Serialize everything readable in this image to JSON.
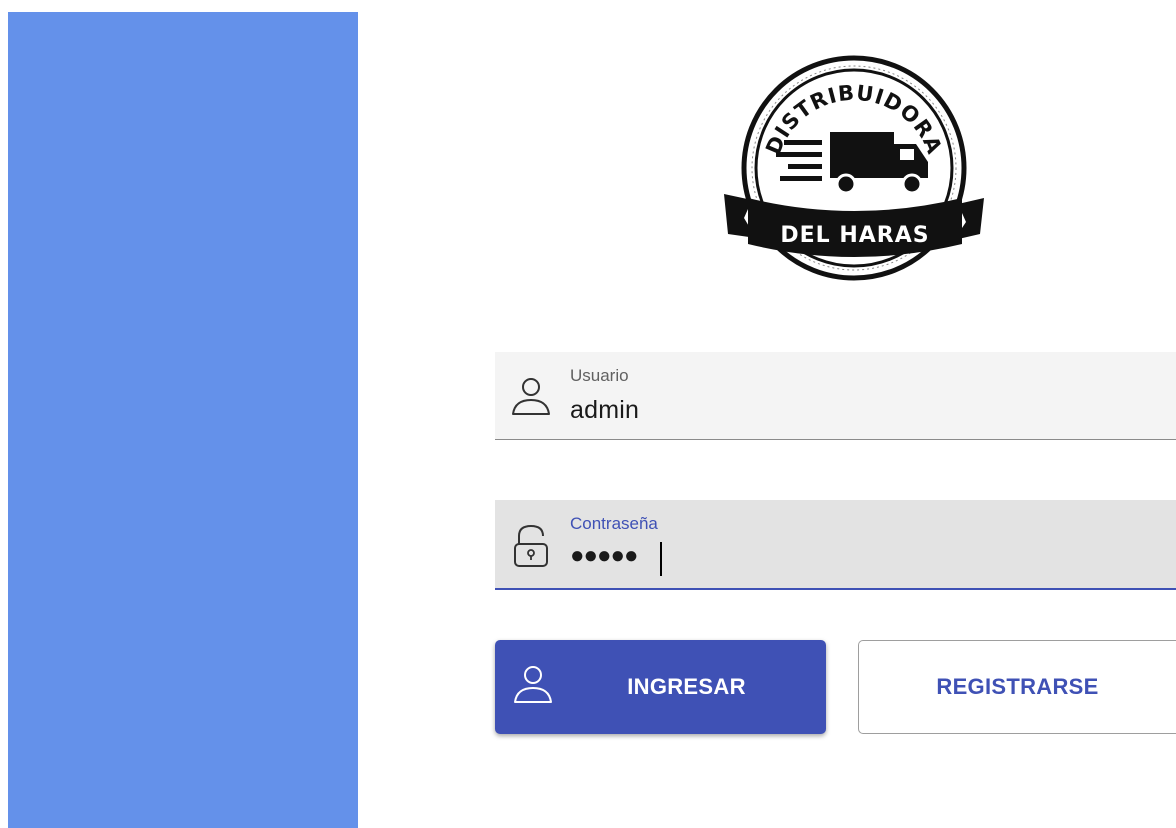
{
  "logo": {
    "line1": "DISTRIBUIDORA",
    "line2": "DEL HARAS"
  },
  "form": {
    "username": {
      "label": "Usuario",
      "value": "admin",
      "icon": "user-icon"
    },
    "password": {
      "label": "Contraseña",
      "value": "●●●●●",
      "icon": "lock-icon"
    }
  },
  "buttons": {
    "login_label": "INGRESAR",
    "register_label": "REGISTRARSE"
  },
  "colors": {
    "side_panel": "#6491ea",
    "primary": "#3f51b5"
  }
}
